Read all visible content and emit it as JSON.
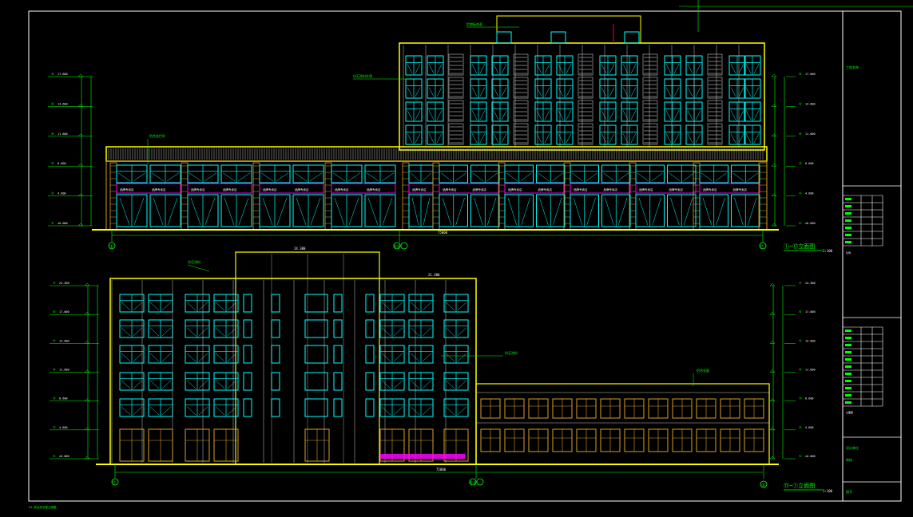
{
  "colors": {
    "background": "#000000",
    "frame": "#ffffff",
    "outline": "#ffff00",
    "glazing": "#00ffff",
    "mullion": "#c8c8c8",
    "shop_frame": "#d9a020",
    "shop_sign": "#ff00ff",
    "dimension": "#00ff00",
    "level_text": "#00ff00",
    "grid_bubble": "#00ff00",
    "marker": "#ff0000"
  },
  "upper_elevation": {
    "title": "①~⑰立面图",
    "scale": "1:100",
    "grid_left": "①",
    "grid_mid": "⑮⑯",
    "grid_right": "⑰",
    "overall_dim": "75800",
    "roof_level": "31.600",
    "ground_level": "-0.300",
    "levels_left": [
      {
        "tag": "④",
        "value": "17.600"
      },
      {
        "tag": "④",
        "value": "14.600"
      },
      {
        "tag": "④",
        "value": "11.600"
      },
      {
        "tag": "③",
        "value": "8.600"
      },
      {
        "tag": "②",
        "value": "4.600"
      },
      {
        "tag": "①",
        "value": "±0.000"
      }
    ],
    "levels_right": [
      {
        "tag": "④",
        "value": "17.600"
      },
      {
        "tag": "④",
        "value": "14.600"
      },
      {
        "tag": "④",
        "value": "11.600"
      },
      {
        "tag": "③",
        "value": "8.600"
      },
      {
        "tag": "②",
        "value": "4.600"
      },
      {
        "tag": "①",
        "value": "±0.000"
      }
    ],
    "annotations": [
      "铝合金栏杆",
      "仿石涂料外墙",
      "铝塑板饰面"
    ],
    "shop_signs": [
      "品牌专卖店",
      "品牌专卖店",
      "品牌专卖店",
      "品牌专卖店",
      "品牌专卖店",
      "品牌专卖店",
      "品牌专卖店",
      "品牌专卖店",
      "品牌专卖店",
      "品牌专卖店",
      "品牌专卖店",
      "品牌专卖店",
      "品牌专卖店",
      "品牌专卖店",
      "品牌专卖店",
      "品牌专卖店",
      "品牌专卖店",
      "品牌专卖店",
      "品牌专卖店",
      "品牌专卖店"
    ]
  },
  "lower_elevation": {
    "title": "⑰~①立面图",
    "scale": "1:100",
    "grid_left": "⑰",
    "grid_mid": "⑮⑯",
    "grid_right": "①",
    "overall_dim": "75800",
    "annotations": [
      "仿石涂料",
      "仿石涂料",
      "铝合金窗"
    ],
    "top_dim_left": "24.300",
    "top_dim_right": "21.300",
    "levels_left": [
      {
        "tag": "⑦",
        "value": "24.300"
      },
      {
        "tag": "⑥",
        "value": "17.600"
      },
      {
        "tag": "⑤",
        "value": "14.600"
      },
      {
        "tag": "④",
        "value": "11.600"
      },
      {
        "tag": "③",
        "value": "8.600"
      },
      {
        "tag": "②",
        "value": "4.600"
      },
      {
        "tag": "①",
        "value": "±0.000"
      }
    ],
    "levels_right": [
      {
        "tag": "⑦",
        "value": "24.300"
      },
      {
        "tag": "⑥",
        "value": "17.600"
      },
      {
        "tag": "⑤",
        "value": "14.600"
      },
      {
        "tag": "④",
        "value": "11.600"
      },
      {
        "tag": "③",
        "value": "8.600"
      },
      {
        "tag": "②",
        "value": "4.600"
      },
      {
        "tag": "①",
        "value": "±0.000"
      }
    ]
  },
  "title_block": {
    "project": "工程名称",
    "row_a": "设计单位",
    "row_b": "审核",
    "row_c": "图号",
    "scale_label": "比例",
    "drawing_name": "立面图"
  },
  "footer_note": "A3-商业综合楼立面图"
}
